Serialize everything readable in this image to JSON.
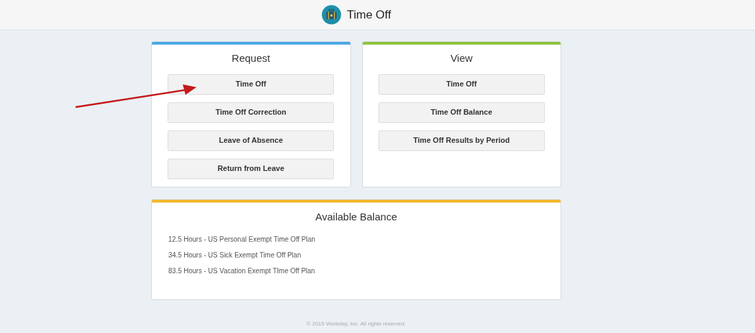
{
  "header": {
    "title": "Time Off"
  },
  "panels": [
    {
      "title": "Request",
      "color": "#4aa8e6",
      "buttons": [
        "Time Off",
        "Time Off Correction",
        "Leave of Absence",
        "Return from Leave"
      ]
    },
    {
      "title": "View",
      "color": "#8cc43f",
      "buttons": [
        "Time Off",
        "Time Off Balance",
        "Time Off Results by Period"
      ]
    }
  ],
  "balance": {
    "title": "Available Balance",
    "color": "#f5b82a",
    "lines": [
      "12.5 Hours - US Personal Exempt Time Off Plan",
      "34.5 Hours - US Sick Exempt Time Off Plan",
      "83.5 Hours - US Vacation Exempt TIme Off Plan"
    ]
  },
  "footer": "© 2015 Workday, Inc. All rights reserved."
}
